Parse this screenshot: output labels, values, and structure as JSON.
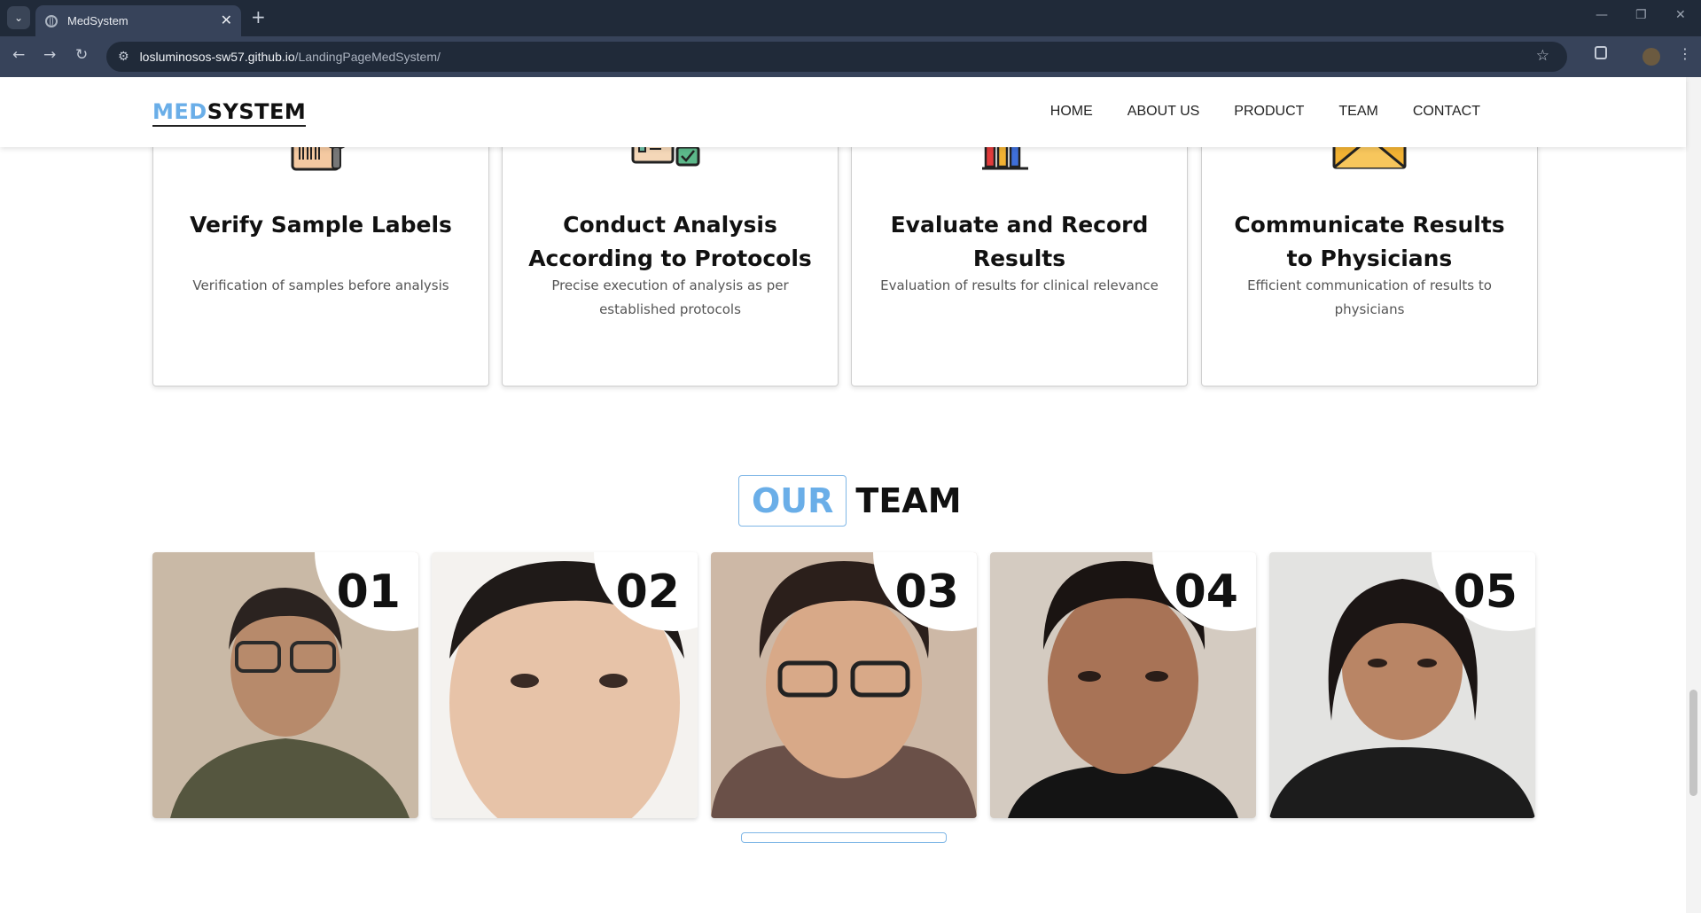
{
  "browser": {
    "tab_title": "MedSystem",
    "new_tab_symbol": "+",
    "close_symbol": "✕",
    "url_host": "losluminosos-sw57.github.io",
    "url_path": "/LandingPageMedSystem/"
  },
  "nav": {
    "logo_accent": "MED",
    "logo_main": "SYSTEM",
    "items": [
      "HOME",
      "ABOUT US",
      "PRODUCT",
      "TEAM",
      "CONTACT"
    ]
  },
  "services": [
    {
      "title": "Verify Sample Labels",
      "description": "Verification of samples before analysis",
      "icon": "barcode-magnifier-icon"
    },
    {
      "title": "Conduct Analysis According to Protocols",
      "description": "Precise execution of analysis as per established protocols",
      "icon": "checklist-clipboard-icon"
    },
    {
      "title": "Evaluate and Record Results",
      "description": "Evaluation of results for clinical relevance",
      "icon": "bar-chart-magnifier-icon"
    },
    {
      "title": "Communicate Results to Physicians",
      "description": "Efficient communication of results to physicians",
      "icon": "envelope-icon"
    }
  ],
  "team": {
    "title_accent": "OUR",
    "title_main": "TEAM",
    "members": [
      {
        "number": "01"
      },
      {
        "number": "02"
      },
      {
        "number": "03"
      },
      {
        "number": "04"
      },
      {
        "number": "05"
      }
    ]
  },
  "colors": {
    "accent": "#6aaee8",
    "chrome_dark": "#202a39",
    "chrome_mid": "#37435a"
  }
}
